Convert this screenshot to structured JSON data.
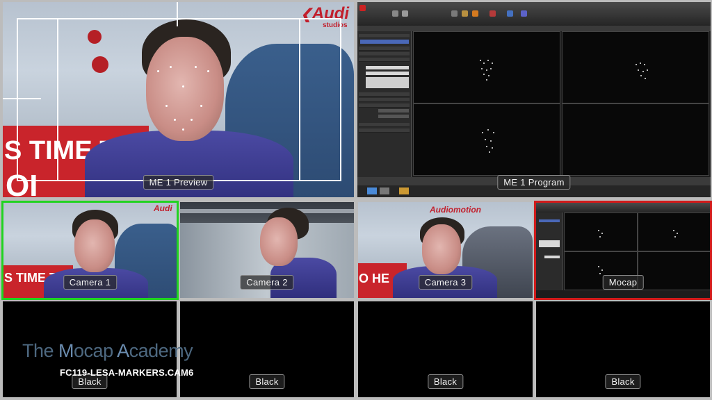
{
  "windows": {
    "preview": {
      "label": "ME 1 Preview"
    },
    "program": {
      "label": "ME 1 Program"
    }
  },
  "inputs": [
    {
      "label": "Camera 1",
      "state": "preview",
      "border_color": "#21d321"
    },
    {
      "label": "Camera 2",
      "state": "idle"
    },
    {
      "label": "Camera 3",
      "state": "idle"
    },
    {
      "label": "Mocap",
      "state": "program",
      "border_color": "#d11b1b"
    }
  ],
  "black_inputs": [
    {
      "label": "Black"
    },
    {
      "label": "Black"
    },
    {
      "label": "Black"
    },
    {
      "label": "Black"
    }
  ],
  "overlay": {
    "brand_parts": [
      "The ",
      "M",
      "ocap ",
      "A",
      "cademy"
    ],
    "clip_name": "FC119-LESA-MARKERS.CAM6"
  },
  "logos": {
    "audio": "Audi",
    "audio_sub": "studios",
    "audiomotion": "Audiomotion"
  },
  "poster": {
    "line1": "S TIME T",
    "line2": "OI",
    "line1_small": "S TIME T",
    "line2_small": "O HE"
  },
  "colors": {
    "preview_tally": "#21d321",
    "program_tally": "#d11b1b",
    "background": "#bcbcbc"
  }
}
